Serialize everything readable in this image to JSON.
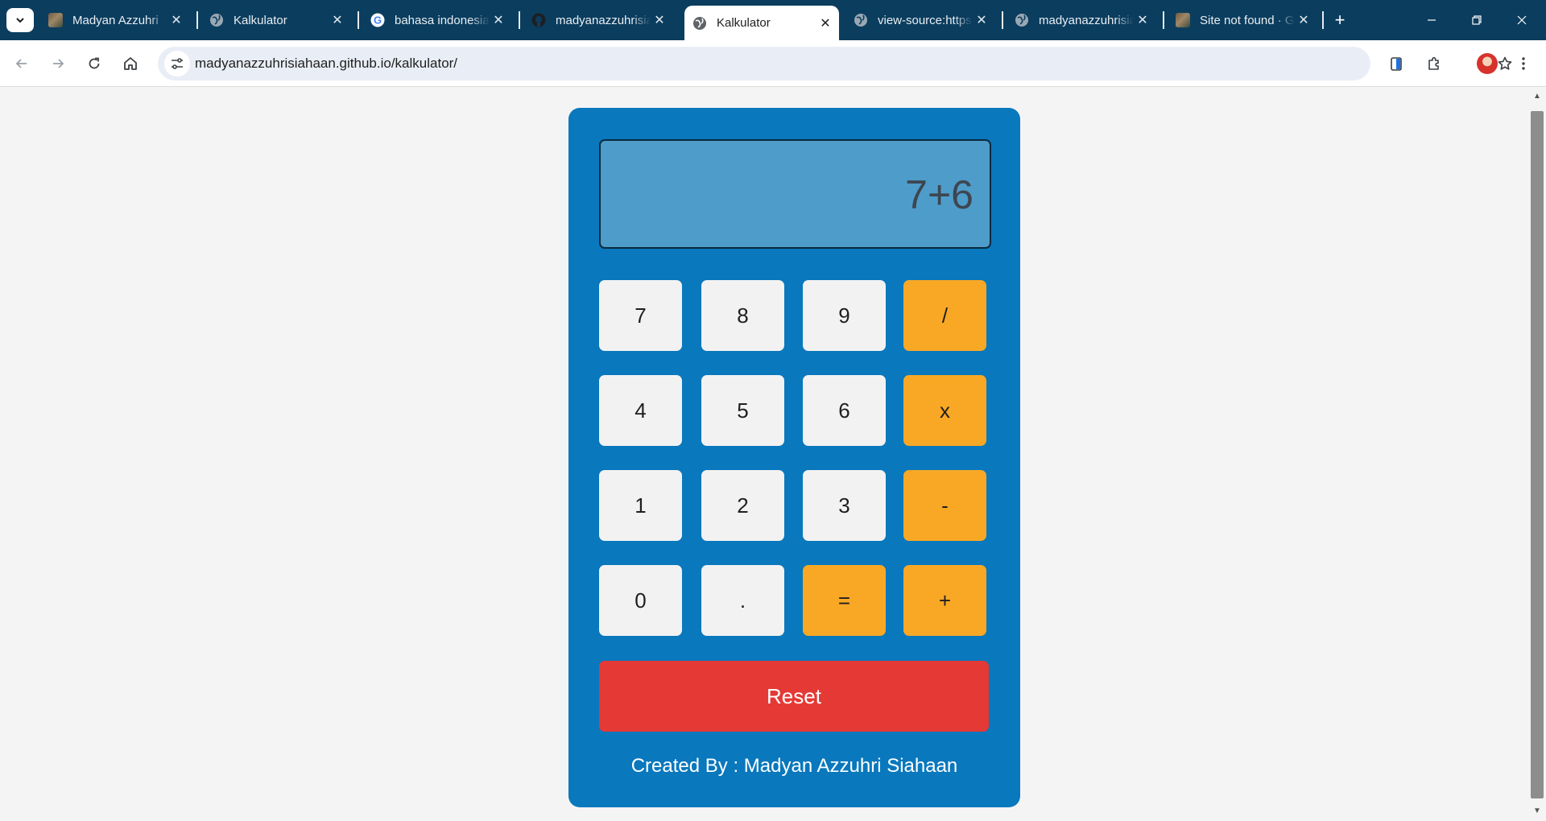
{
  "browser": {
    "tabs": [
      {
        "title": "Madyan Azzuhri",
        "favicon": "photo-favicon",
        "active": false
      },
      {
        "title": "Kalkulator",
        "favicon": "globe-favicon",
        "active": false
      },
      {
        "title": "bahasa indonesia",
        "favicon": "google-favicon",
        "active": false
      },
      {
        "title": "madyanazzuhrisiahaan",
        "favicon": "github-favicon",
        "active": false
      },
      {
        "title": "Kalkulator",
        "favicon": "globe-favicon",
        "active": true
      },
      {
        "title": "view-source:https",
        "favicon": "globe-favicon",
        "active": false
      },
      {
        "title": "madyanazzuhrisiahaan",
        "favicon": "globe-favicon",
        "active": false
      },
      {
        "title": "Site not found · GitHub",
        "favicon": "photo-favicon",
        "active": false
      }
    ],
    "close_glyph": "✕",
    "new_tab_glyph": "+",
    "url": "madyanazzuhrisiahaan.github.io/kalkulator/"
  },
  "calculator": {
    "display": "7+6",
    "keys": [
      {
        "label": "7",
        "type": "digit"
      },
      {
        "label": "8",
        "type": "digit"
      },
      {
        "label": "9",
        "type": "digit"
      },
      {
        "label": "/",
        "type": "operator"
      },
      {
        "label": "4",
        "type": "digit"
      },
      {
        "label": "5",
        "type": "digit"
      },
      {
        "label": "6",
        "type": "digit"
      },
      {
        "label": "x",
        "type": "operator"
      },
      {
        "label": "1",
        "type": "digit"
      },
      {
        "label": "2",
        "type": "digit"
      },
      {
        "label": "3",
        "type": "digit"
      },
      {
        "label": "-",
        "type": "operator"
      },
      {
        "label": "0",
        "type": "digit"
      },
      {
        "label": ".",
        "type": "digit"
      },
      {
        "label": "=",
        "type": "operator"
      },
      {
        "label": "+",
        "type": "operator"
      }
    ],
    "reset_label": "Reset",
    "credit": "Created By : Madyan Azzuhri Siahaan"
  },
  "colors": {
    "tab_strip": "#0b3d5e",
    "calculator_body": "#0978bd",
    "display": "#4e9cca",
    "digit_key": "#f2f2f2",
    "operator_key": "#f9a825",
    "reset_button": "#e53935"
  }
}
